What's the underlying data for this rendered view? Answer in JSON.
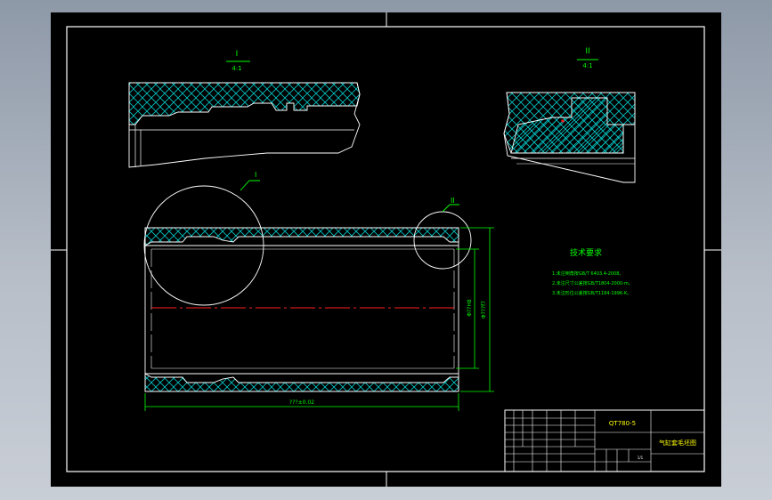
{
  "drawing": {
    "detail_views": [
      {
        "label": "I",
        "scale": "4:1"
      },
      {
        "label": "II",
        "scale": "4:1"
      }
    ],
    "callouts": {
      "detail_one": "I",
      "detail_two": "II"
    },
    "dimensions": {
      "length": "???±0.02",
      "inner_diameter": "Φ??H8",
      "outer_diameter": "Φ???f7"
    },
    "technical_requirements": {
      "title": "技术要求",
      "items": [
        "1.未注倒角按GB/T 6403.4-2008。",
        "2.未注尺寸公差按GB/T1804-2000-m。",
        "3.未注形位公差按GB/T1184-1996-K。"
      ]
    },
    "title_block": {
      "drawing_number": "QT780-5",
      "part_name": "气缸套毛坯图",
      "sheet": "1/1"
    }
  },
  "colors": {
    "sheet_background": "#000000",
    "frame_lines": "#ffffff",
    "hatch": "#00c8c8",
    "dimension": "#00ff00",
    "centerline": "#ff2020"
  }
}
